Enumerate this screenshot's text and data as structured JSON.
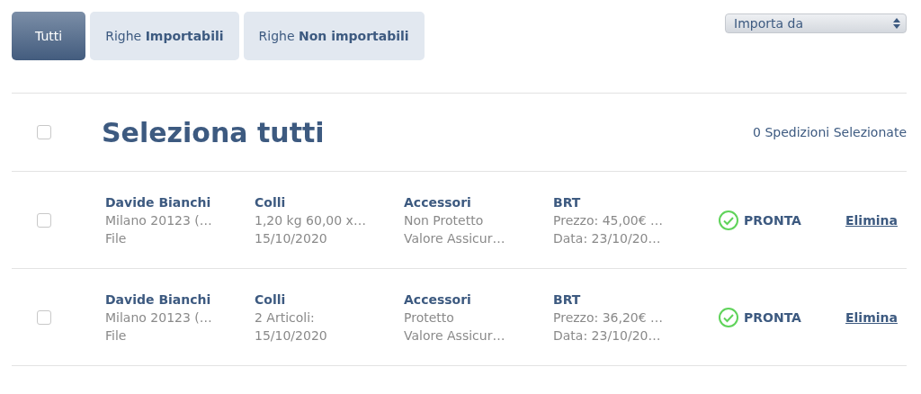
{
  "tabs": [
    {
      "label": "Tutti",
      "selected": true
    },
    {
      "label": "Righe **Importabili**",
      "selected": false
    },
    {
      "label": "Righe **Non importabili**",
      "selected": false
    }
  ],
  "import_select": {
    "value": "Importa da"
  },
  "header": {
    "checked": false,
    "title": "Seleziona tutti",
    "count": "0 Spedizioni Selezionate"
  },
  "rows": [
    {
      "checked": false,
      "columns": [
        {
          "title": "Davide Bianchi",
          "lines": [
            "Milano 20123 (…",
            "File"
          ]
        },
        {
          "title": "Colli",
          "lines": [
            "1,20 kg 60,00 x…",
            "15/10/2020"
          ]
        },
        {
          "title": "Accessori",
          "lines": [
            "Non Protetto",
            "Valore Assicur…"
          ]
        },
        {
          "title": "BRT",
          "lines": [
            "Prezzo: 45,00€ …",
            "Data: 23/10/20…"
          ]
        }
      ],
      "status": {
        "kind": "ready",
        "label": "PRONTA"
      },
      "action": "Elimina"
    },
    {
      "checked": false,
      "columns": [
        {
          "title": "Davide Bianchi",
          "lines": [
            "Milano 20123 (…",
            "File"
          ]
        },
        {
          "title": "Colli",
          "lines": [
            "2 Articoli:",
            "15/10/2020"
          ]
        },
        {
          "title": "Accessori",
          "lines": [
            "Protetto",
            "Valore Assicur…"
          ]
        },
        {
          "title": "BRT",
          "lines": [
            "Prezzo: 36,20€ …",
            "Data: 23/10/20…"
          ]
        }
      ],
      "status": {
        "kind": "ready",
        "label": "PRONTA"
      },
      "action": "Elimina"
    }
  ]
}
